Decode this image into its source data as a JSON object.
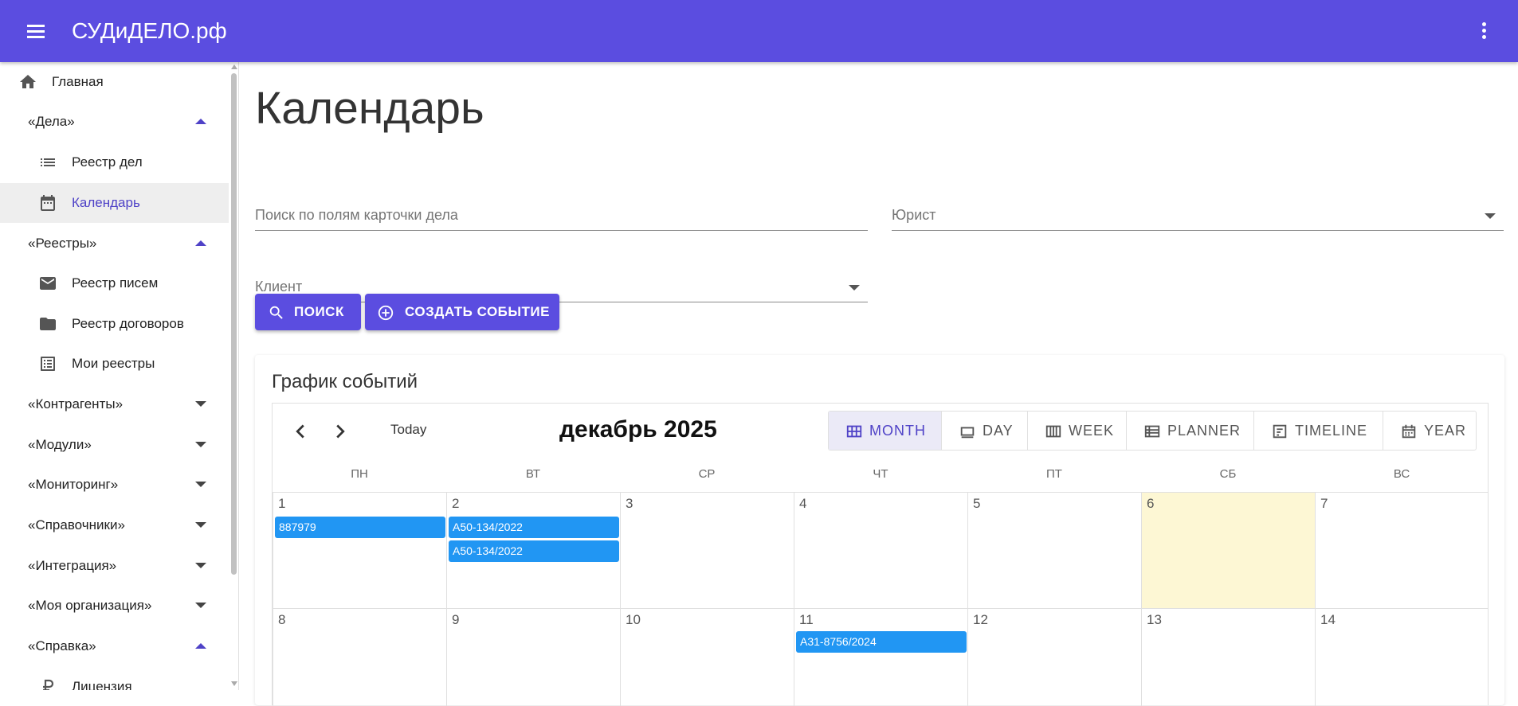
{
  "app": {
    "title": "СУДиДЕЛО.рф"
  },
  "sidebar": {
    "home": "Главная",
    "cases_group": "«Дела»",
    "cases_registry": "Реестр дел",
    "calendar": "Календарь",
    "registries_group": "«Реестры»",
    "letters_registry": "Реестр писем",
    "contracts_registry": "Реестр договоров",
    "my_registries": "Мои реестры",
    "counterparties_group": "«Контрагенты»",
    "modules_group": "«Модули»",
    "monitoring_group": "«Мониторинг»",
    "references_group": "«Справочники»",
    "integration_group": "«Интеграция»",
    "my_org_group": "«Моя организация»",
    "help_group": "«Справка»",
    "license": "Лицензия"
  },
  "page": {
    "title": "Календарь"
  },
  "filters": {
    "search_placeholder": "Поиск по полям карточки дела",
    "lawyer_label": "Юрист",
    "client_label": "Клиент"
  },
  "buttons": {
    "search": "ПОИСК",
    "create_event": "СОЗДАТЬ СОБЫТИЕ"
  },
  "schedule": {
    "title": "График событий",
    "today_label": "Today",
    "month_title": "декабрь 2025",
    "views": [
      "MONTH",
      "DAY",
      "WEEK",
      "PLANNER",
      "TIMELINE",
      "YEAR"
    ],
    "active_view": "MONTH",
    "weekdays": [
      "ПН",
      "ВТ",
      "СР",
      "ЧТ",
      "ПТ",
      "СБ",
      "ВС"
    ],
    "weeks": [
      [
        "1",
        "2",
        "3",
        "4",
        "5",
        "6",
        "7"
      ],
      [
        "8",
        "9",
        "10",
        "11",
        "12",
        "13",
        "14"
      ]
    ],
    "events": {
      "d1": [
        "887979"
      ],
      "d2": [
        "А50-134/2022",
        "А50-134/2022"
      ],
      "d11": [
        "А31-8756/2024"
      ]
    }
  },
  "colors": {
    "primary": "#5b4de0",
    "event": "#2196f3",
    "today_highlight": "#fdf7d4"
  }
}
